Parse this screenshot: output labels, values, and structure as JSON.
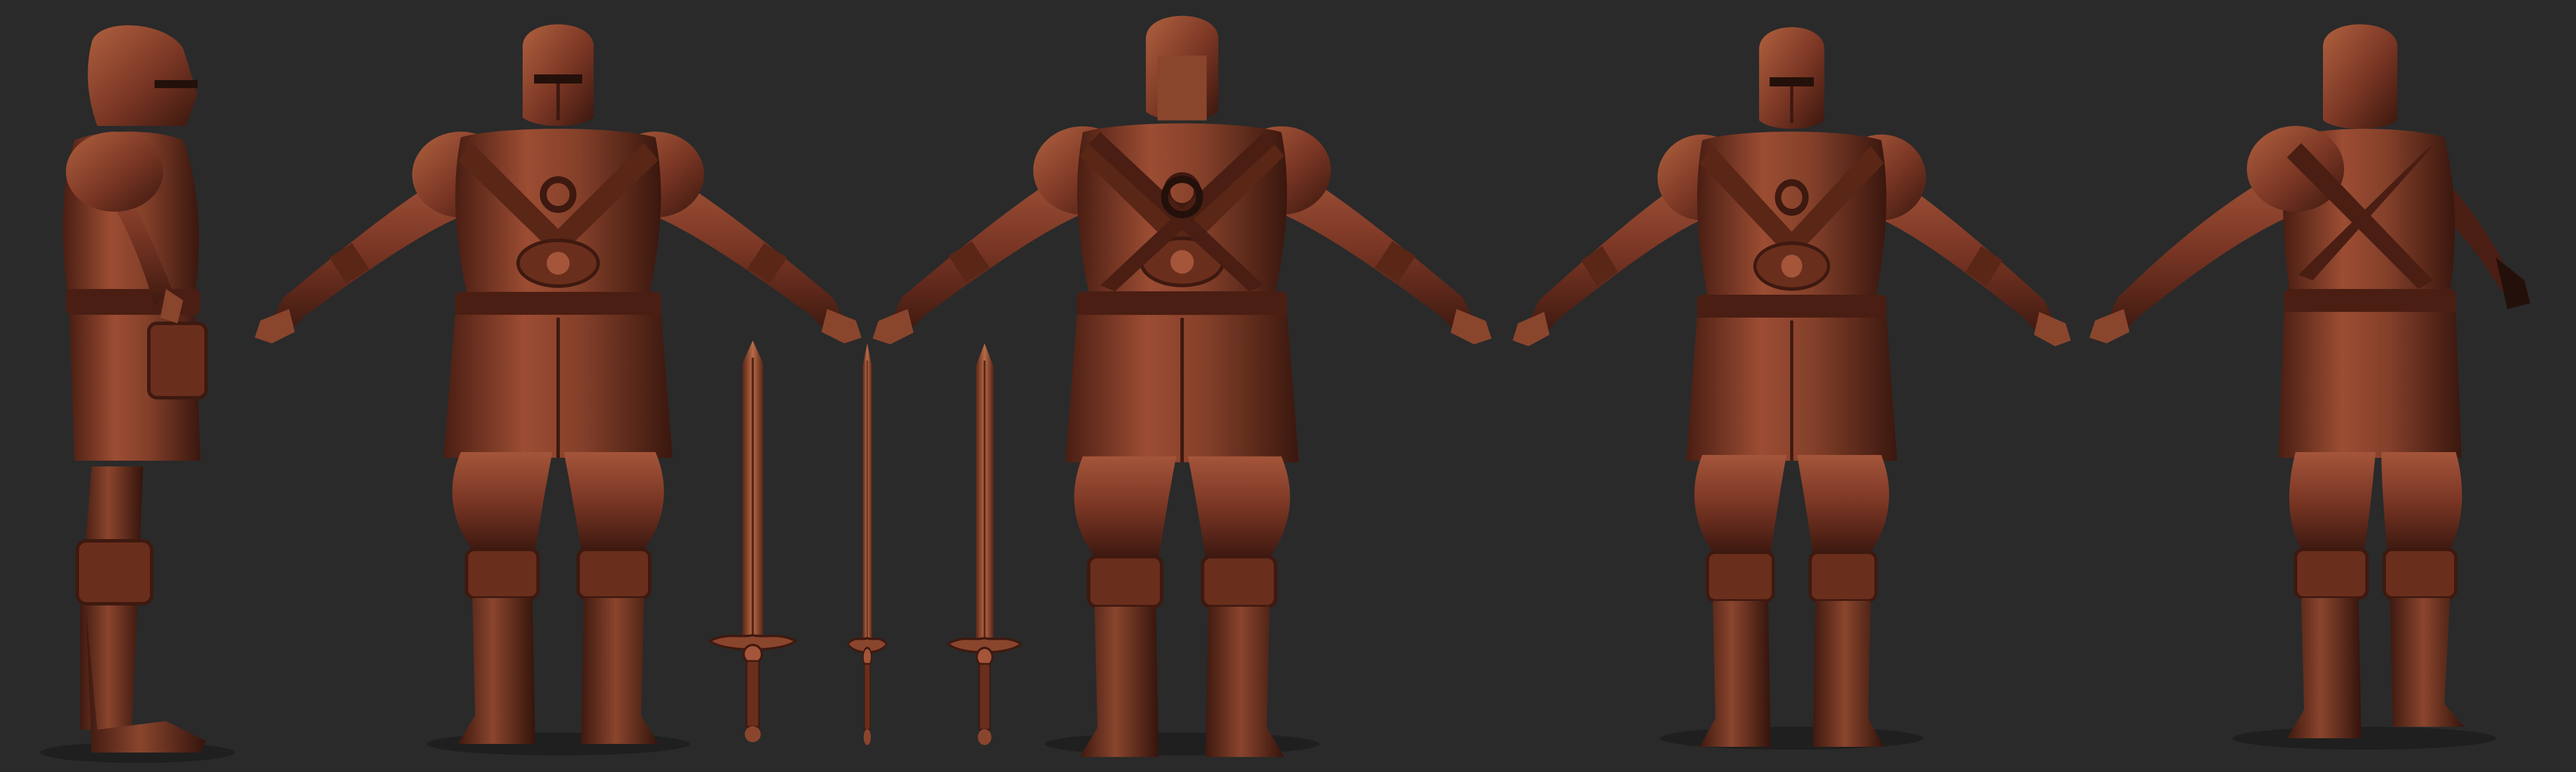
{
  "scene": {
    "background": "#2a2a2a",
    "material": {
      "base": "#7a3624",
      "light": "#a4553a",
      "highlight": "#c4734f",
      "shadow": "#3e1910",
      "deep": "#24100a"
    },
    "views": [
      {
        "id": "knight-side-view",
        "name": "side"
      },
      {
        "id": "knight-front-view",
        "name": "front"
      },
      {
        "id": "knight-back-view",
        "name": "back"
      },
      {
        "id": "knight-three-quarter-front-view",
        "name": "three-quarter-front"
      },
      {
        "id": "knight-three-quarter-back-view",
        "name": "three-quarter-back"
      }
    ],
    "props": [
      {
        "id": "sword-front-view",
        "name": "sword-front"
      },
      {
        "id": "sword-side-view",
        "name": "sword-side"
      },
      {
        "id": "sword-angled-view",
        "name": "sword-angled"
      }
    ]
  }
}
